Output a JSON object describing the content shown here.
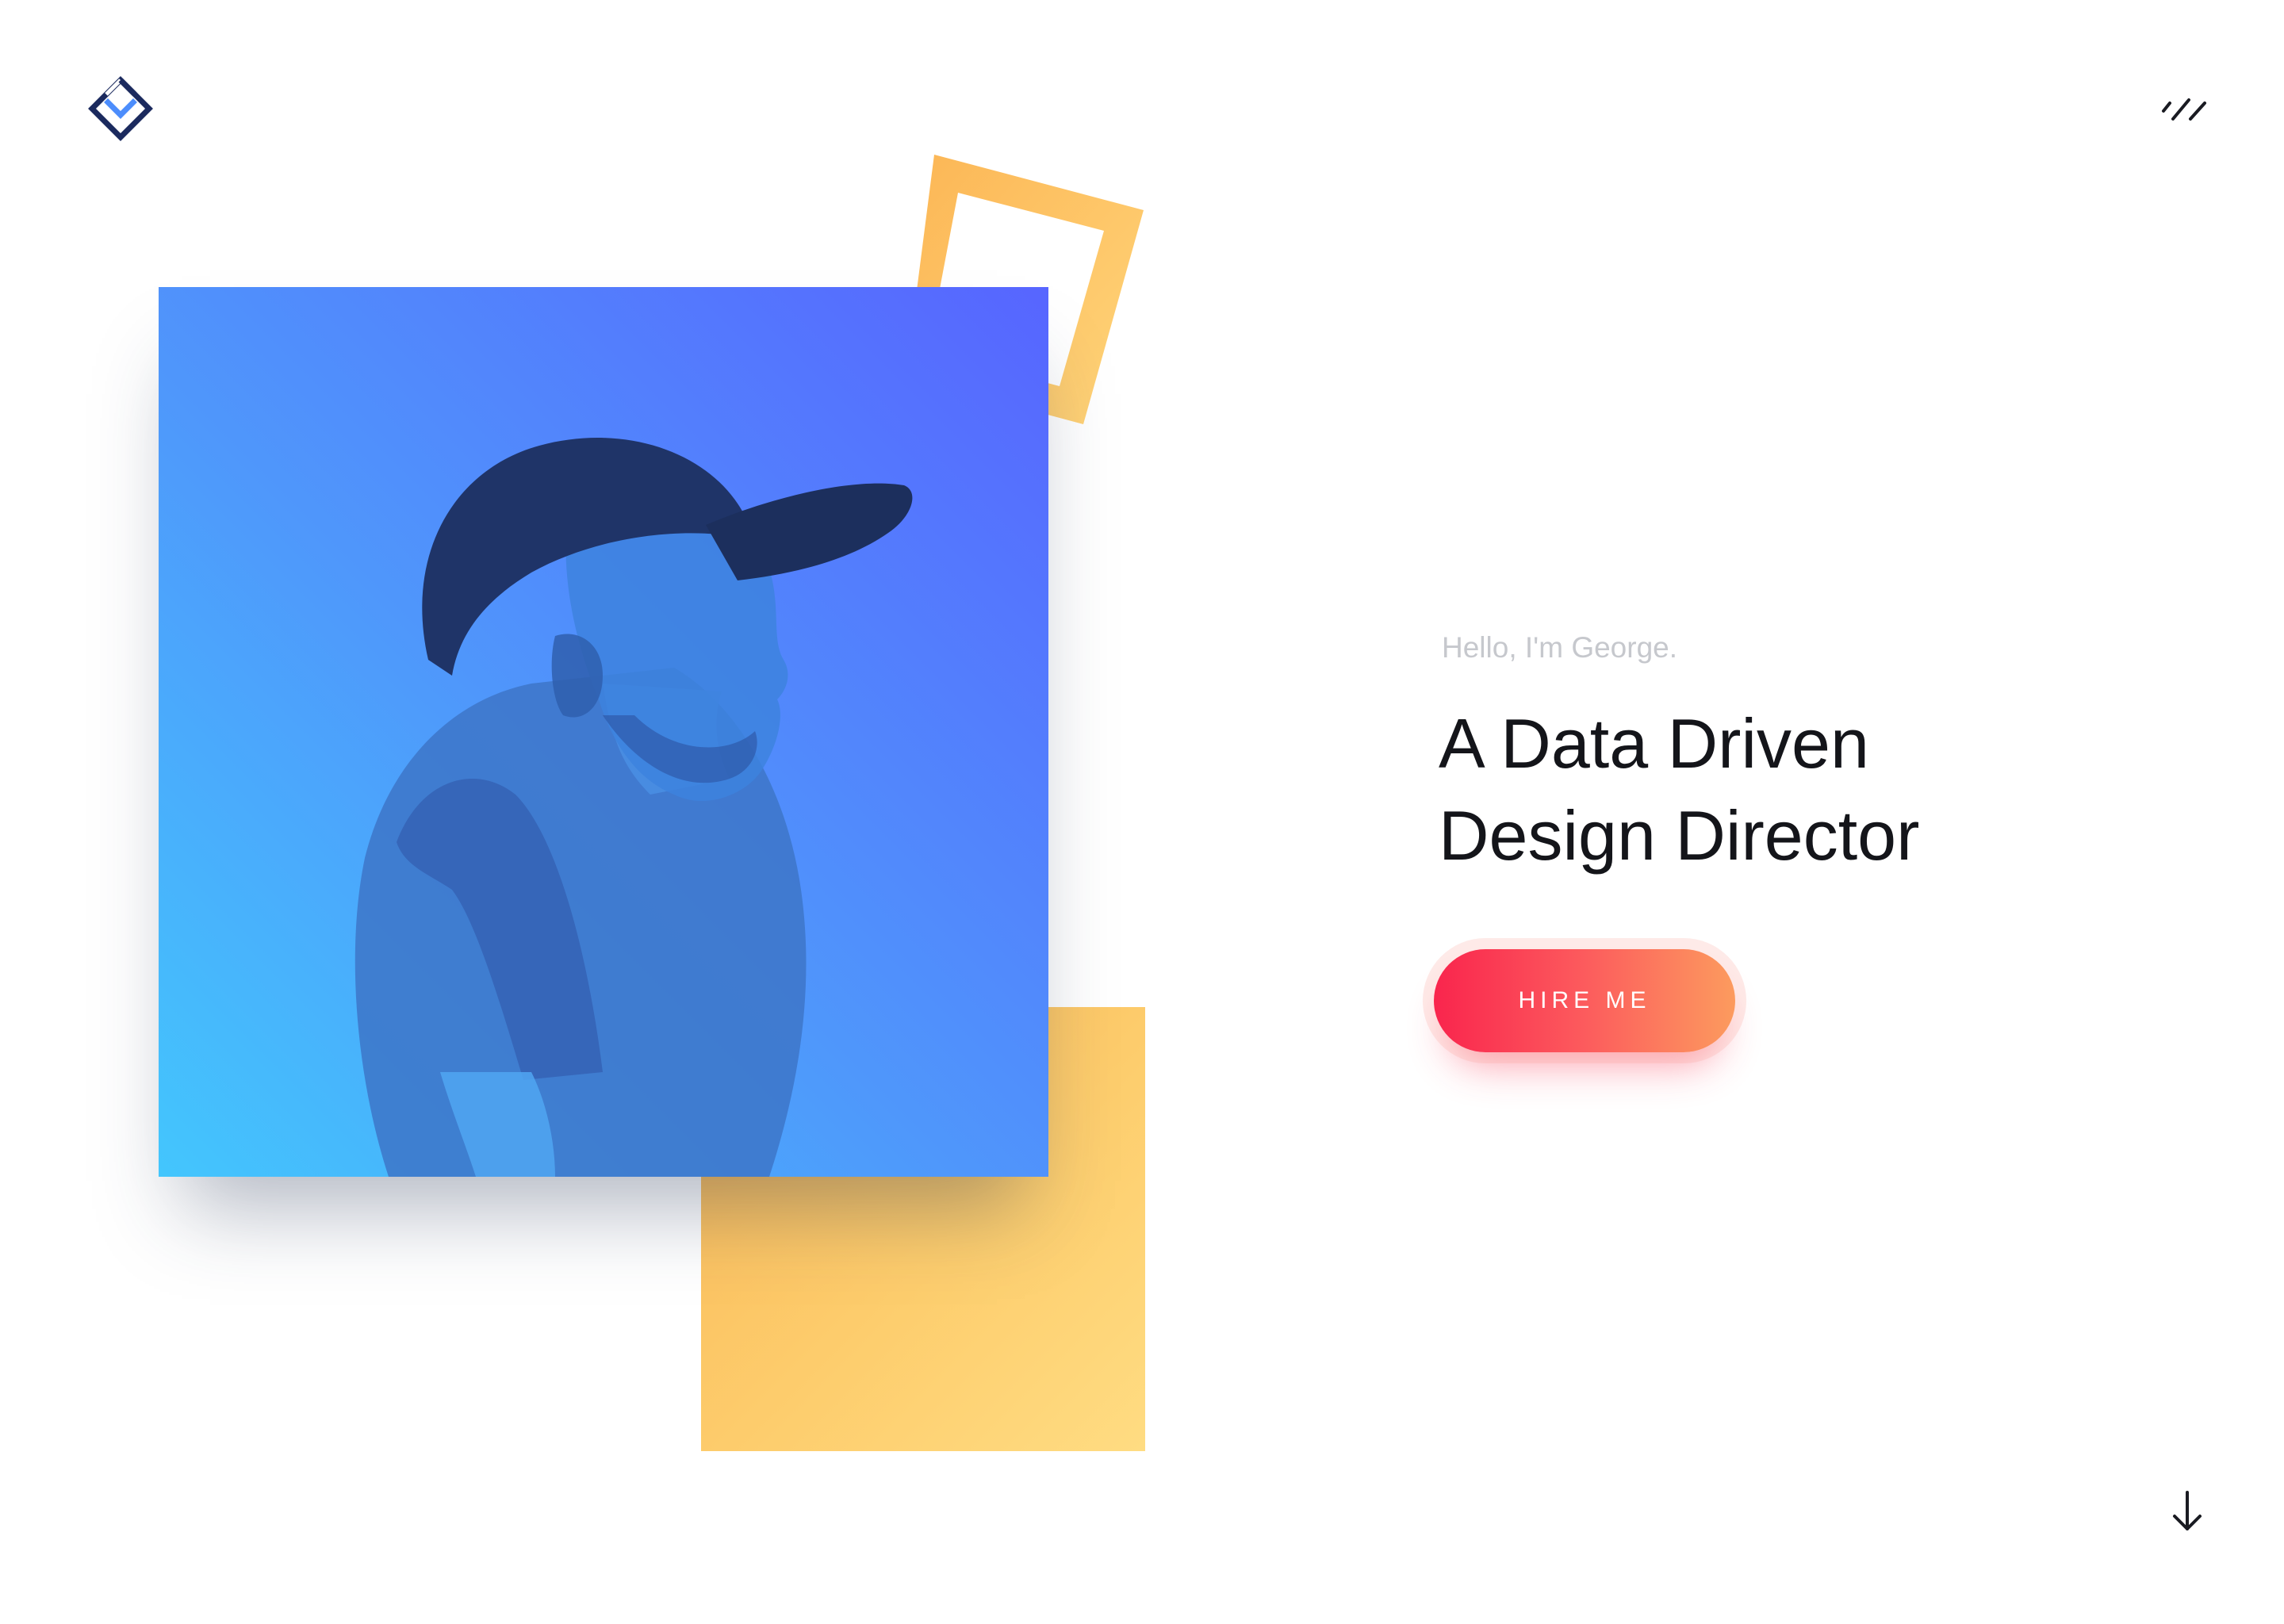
{
  "brand": {
    "logo_icon": "diamond-logo-icon",
    "navy": "#1b2a5e",
    "blue": "#4c8dfc"
  },
  "nav": {
    "menu_icon": "slash-menu-icon"
  },
  "hero": {
    "greeting": "Hello, I'm George.",
    "headline_line1": "A Data Driven",
    "headline_line2": "Design Director",
    "cta_label": "HIRE ME",
    "portrait_icon": "profile-portrait-image",
    "accent_yellow": "#fdcd6d",
    "accent_blue": "#4f97fb"
  },
  "footer": {
    "scroll_icon": "arrow-down-icon"
  }
}
